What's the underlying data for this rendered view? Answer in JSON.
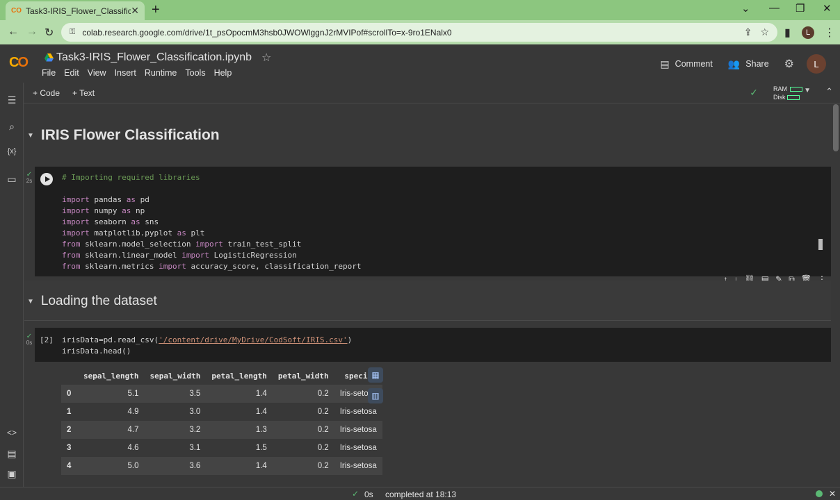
{
  "browser": {
    "tab_title": "Task3-IRIS_Flower_Classification",
    "url": "colab.research.google.com/drive/1t_psOpocmM3hsb0JWOWlggnJ2rMVIPof#scrollTo=x-9ro1ENalx0",
    "profile_initial": "L"
  },
  "colab": {
    "notebook_title": "Task3-IRIS_Flower_Classification.ipynb",
    "menu": [
      "File",
      "Edit",
      "View",
      "Insert",
      "Runtime",
      "Tools",
      "Help"
    ],
    "comment_label": "Comment",
    "share_label": "Share",
    "avatar_initial": "L",
    "add_code_label": "+ Code",
    "add_text_label": "+ Text",
    "ram_label": "RAM",
    "disk_label": "Disk"
  },
  "notebook": {
    "heading1": "IRIS Flower Classification",
    "cell1_status": "2s",
    "cell1_code": {
      "comment": "# Importing required libraries",
      "lines": [
        [
          "import",
          " pandas ",
          "as",
          " pd"
        ],
        [
          "import",
          " numpy ",
          "as",
          " np"
        ],
        [
          "import",
          " seaborn ",
          "as",
          " sns"
        ],
        [
          "import",
          " matplotlib.pyplot ",
          "as",
          " plt"
        ],
        [
          "from",
          " sklearn.model_selection ",
          "import",
          " train_test_split"
        ],
        [
          "from",
          " sklearn.linear_model ",
          "import",
          " LogisticRegression"
        ],
        [
          "from",
          " sklearn.metrics ",
          "import",
          " accuracy_score, classification_report"
        ]
      ]
    },
    "heading2": "Loading the dataset",
    "cell2_exec": "[2]",
    "cell2_status": "0s",
    "cell2_line1_a": "irisData=pd.read_csv(",
    "cell2_line1_str": "'/content/drive/MyDrive/CodSoft/IRIS.csv'",
    "cell2_line1_b": ")",
    "cell2_line2": "irisData.head()",
    "dataframe": {
      "columns": [
        "",
        "sepal_length",
        "sepal_width",
        "petal_length",
        "petal_width",
        "species"
      ],
      "rows": [
        [
          "0",
          "5.1",
          "3.5",
          "1.4",
          "0.2",
          "Iris-setosa"
        ],
        [
          "1",
          "4.9",
          "3.0",
          "1.4",
          "0.2",
          "Iris-setosa"
        ],
        [
          "2",
          "4.7",
          "3.2",
          "1.3",
          "0.2",
          "Iris-setosa"
        ],
        [
          "3",
          "4.6",
          "3.1",
          "1.5",
          "0.2",
          "Iris-setosa"
        ],
        [
          "4",
          "5.0",
          "3.6",
          "1.4",
          "0.2",
          "Iris-setosa"
        ]
      ]
    }
  },
  "statusbar": {
    "elapsed": "0s",
    "completed": "completed at 18:13"
  },
  "colors": {
    "chrome_green": "#8cc67f",
    "cell_bg": "#1e1e1e",
    "page_bg": "#383838",
    "ok_green": "#5bb974"
  }
}
